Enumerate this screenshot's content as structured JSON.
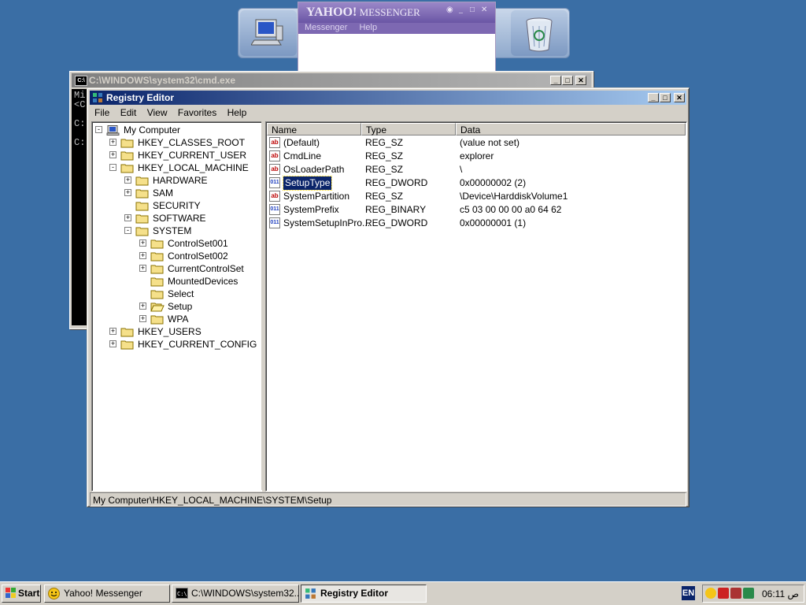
{
  "dock": {
    "icons": [
      "computer-icon",
      "recycle-bin-icon"
    ]
  },
  "yahoo": {
    "logo": "YAHOO!",
    "title": "MESSENGER",
    "menu": [
      "Messenger",
      "Help"
    ]
  },
  "cmd": {
    "title": "C:\\WINDOWS\\system32\\cmd.exe",
    "lines": [
      "Mi",
      "<C",
      "C:",
      "C:"
    ]
  },
  "regedit": {
    "title": "Registry Editor",
    "menu": [
      "File",
      "Edit",
      "View",
      "Favorites",
      "Help"
    ],
    "tree": [
      {
        "label": "My Computer",
        "level": 0,
        "expander": "-",
        "icon": "computer-icon"
      },
      {
        "label": "HKEY_CLASSES_ROOT",
        "level": 1,
        "expander": "+",
        "icon": "folder-icon"
      },
      {
        "label": "HKEY_CURRENT_USER",
        "level": 1,
        "expander": "+",
        "icon": "folder-icon"
      },
      {
        "label": "HKEY_LOCAL_MACHINE",
        "level": 1,
        "expander": "-",
        "icon": "folder-icon"
      },
      {
        "label": "HARDWARE",
        "level": 2,
        "expander": "+",
        "icon": "folder-icon"
      },
      {
        "label": "SAM",
        "level": 2,
        "expander": "+",
        "icon": "folder-icon"
      },
      {
        "label": "SECURITY",
        "level": 2,
        "expander": "",
        "icon": "folder-icon"
      },
      {
        "label": "SOFTWARE",
        "level": 2,
        "expander": "+",
        "icon": "folder-icon"
      },
      {
        "label": "SYSTEM",
        "level": 2,
        "expander": "-",
        "icon": "folder-icon"
      },
      {
        "label": "ControlSet001",
        "level": 3,
        "expander": "+",
        "icon": "folder-icon"
      },
      {
        "label": "ControlSet002",
        "level": 3,
        "expander": "+",
        "icon": "folder-icon"
      },
      {
        "label": "CurrentControlSet",
        "level": 3,
        "expander": "+",
        "icon": "folder-icon"
      },
      {
        "label": "MountedDevices",
        "level": 3,
        "expander": "",
        "icon": "folder-icon"
      },
      {
        "label": "Select",
        "level": 3,
        "expander": "",
        "icon": "folder-icon"
      },
      {
        "label": "Setup",
        "level": 3,
        "expander": "+",
        "icon": "open-folder-icon"
      },
      {
        "label": "WPA",
        "level": 3,
        "expander": "+",
        "icon": "folder-icon"
      },
      {
        "label": "HKEY_USERS",
        "level": 1,
        "expander": "+",
        "icon": "folder-icon"
      },
      {
        "label": "HKEY_CURRENT_CONFIG",
        "level": 1,
        "expander": "+",
        "icon": "folder-icon"
      }
    ],
    "columns": [
      "Name",
      "Type",
      "Data"
    ],
    "values": [
      {
        "name": "(Default)",
        "type": "REG_SZ",
        "data": "(value not set)",
        "icon": "string-value-icon",
        "selected": false
      },
      {
        "name": "CmdLine",
        "type": "REG_SZ",
        "data": "explorer",
        "icon": "string-value-icon",
        "selected": false
      },
      {
        "name": "OsLoaderPath",
        "type": "REG_SZ",
        "data": "\\",
        "icon": "string-value-icon",
        "selected": false
      },
      {
        "name": "SetupType",
        "type": "REG_DWORD",
        "data": "0x00000002 (2)",
        "icon": "binary-value-icon",
        "selected": true
      },
      {
        "name": "SystemPartition",
        "type": "REG_SZ",
        "data": "\\Device\\HarddiskVolume1",
        "icon": "string-value-icon",
        "selected": false
      },
      {
        "name": "SystemPrefix",
        "type": "REG_BINARY",
        "data": "c5 03 00 00 00 a0 64 62",
        "icon": "binary-value-icon",
        "selected": false
      },
      {
        "name": "SystemSetupInPro...",
        "type": "REG_DWORD",
        "data": "0x00000001 (1)",
        "icon": "binary-value-icon",
        "selected": false
      }
    ],
    "status": "My Computer\\HKEY_LOCAL_MACHINE\\SYSTEM\\Setup"
  },
  "taskbar": {
    "start": "Start",
    "buttons": [
      {
        "label": "Yahoo! Messenger",
        "icon": "yahoo-icon",
        "active": false
      },
      {
        "label": "C:\\WINDOWS\\system32...",
        "icon": "cmd-icon",
        "active": false
      },
      {
        "label": "Registry Editor",
        "icon": "regedit-icon",
        "active": true
      }
    ],
    "lang": "EN",
    "clock": "06:11 ص"
  }
}
